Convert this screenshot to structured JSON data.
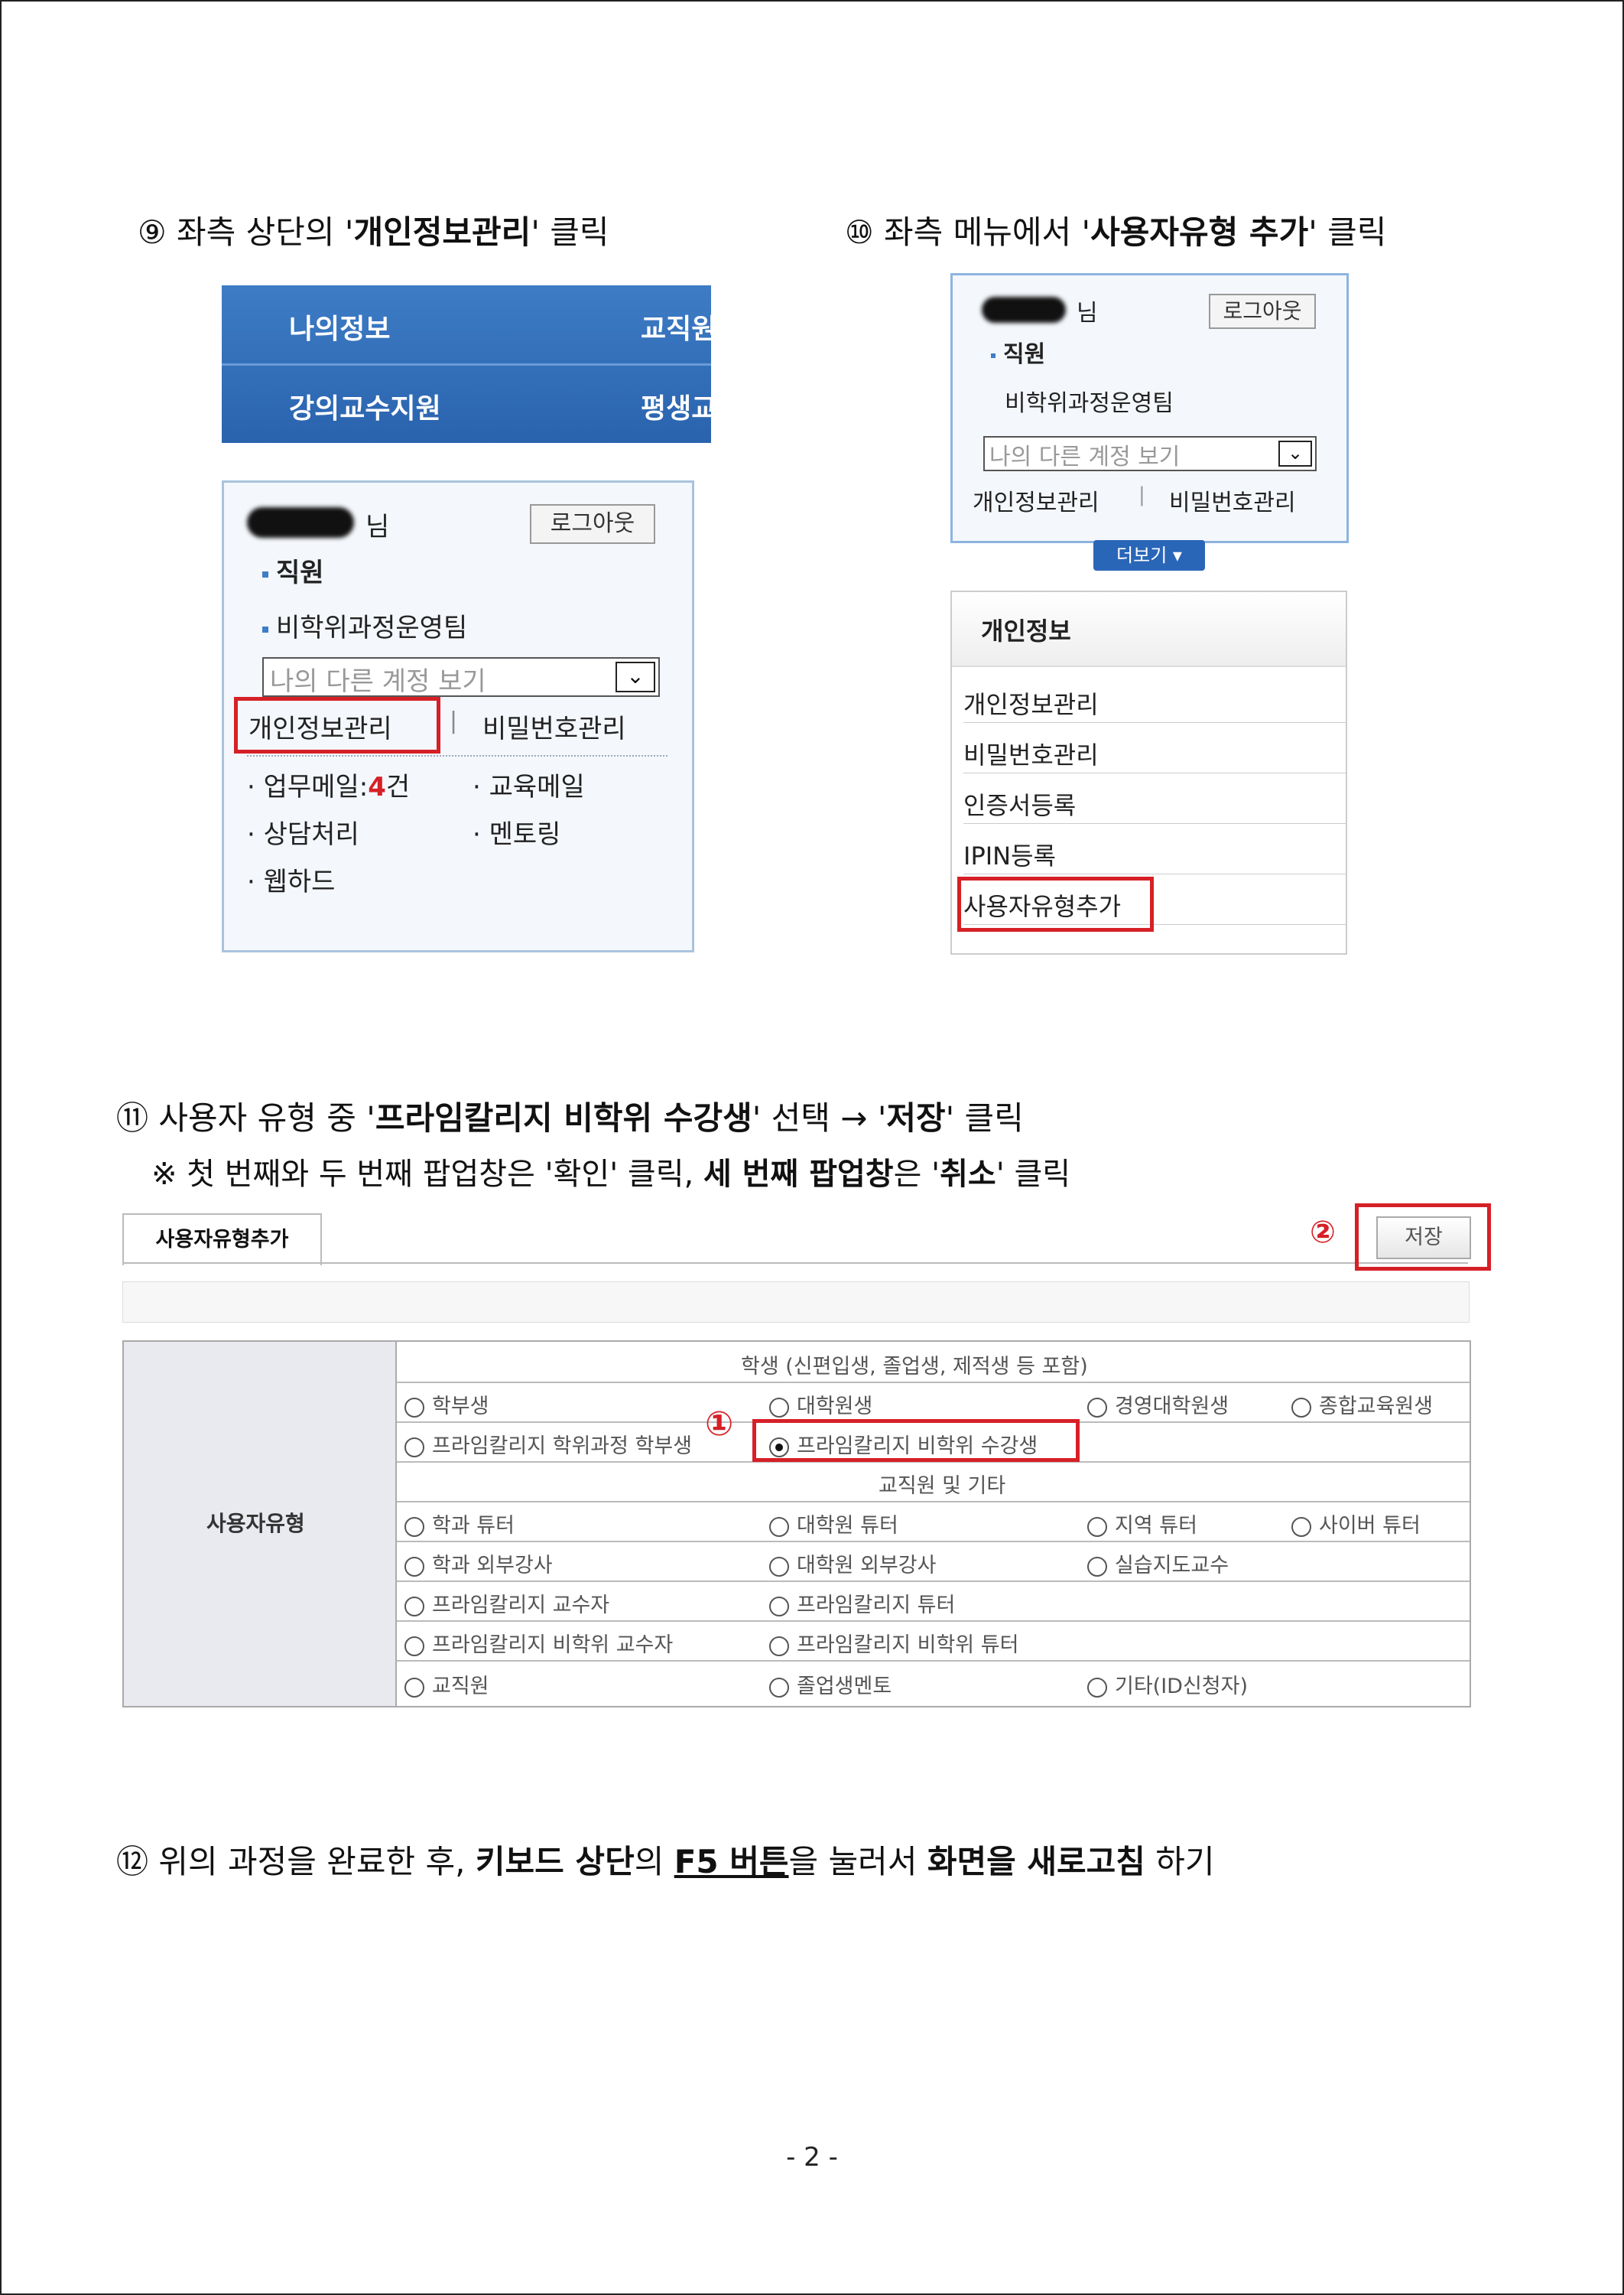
{
  "steps": {
    "s9_num": "⑨",
    "s9_pre": " 좌측 상단의 '",
    "s9_bold": "개인정보관리",
    "s9_post": "' 클릭",
    "s10_num": "⑩",
    "s10_pre": " 좌측 메뉴에서 '",
    "s10_bold": "사용자유형 추가",
    "s10_post": "' 클릭",
    "s11_num": "⑪",
    "s11_pre": " 사용자 유형 중 '",
    "s11_bold1": "프라임칼리지 비학위 수강생",
    "s11_mid": "' 선택 → '",
    "s11_bold2": "저장",
    "s11_post": "' 클릭",
    "note_pre": "※ 첫 번째와 두 번째 팝업창은 '확인' 클릭, ",
    "note_bold1": "세 번째 팝업창",
    "note_mid": "은 '",
    "note_bold2": "취소",
    "note_post": "' 클릭",
    "s12_num": "⑫",
    "s12_pre": " 위의 과정을 완료한 후, ",
    "s12_bold1": "키보드 상단",
    "s12_mid1": "의 ",
    "s12_bold2": "F5 버튼",
    "s12_mid2": "을 눌러서 ",
    "s12_bold3": "화면을 새로고침",
    "s12_post": " 하기"
  },
  "nav": {
    "item1": "나의정보",
    "item2": "교직원",
    "item3": "강의교수지원",
    "item4": "평생교"
  },
  "login_panel": {
    "suffix": "님",
    "logout": "로그아웃",
    "role": "직원",
    "team": "비학위과정운영팀",
    "select": "나의 다른 계정 보기",
    "link_profile": "개인정보관리",
    "sep": "|",
    "link_password": "비밀번호관리",
    "mail_label": "업무메일:",
    "mail_count": "4",
    "mail_unit": "건",
    "edu_mail": "교육메일",
    "counsel": "상담처리",
    "mentoring": "멘토링",
    "webhard": "웹하드"
  },
  "login_panel2": {
    "more": "더보기 ▾"
  },
  "submenu": {
    "title": "개인정보",
    "items": [
      "개인정보관리",
      "비밀번호관리",
      "인증서등록",
      "IPIN등록",
      "사용자유형추가"
    ]
  },
  "form": {
    "tab": "사용자유형추가",
    "marker2": "②",
    "save": "저장",
    "label": "사용자유형",
    "marker1": "①",
    "section1": "학생 (신편입생, 졸업생, 제적생 등 포함)",
    "section2": "교직원 및 기타",
    "r1": [
      "학부생",
      "대학원생",
      "경영대학원생",
      "종합교육원생"
    ],
    "r2": [
      "프라임칼리지 학위과정 학부생",
      "프라임칼리지 비학위 수강생"
    ],
    "r3": [
      "학과 튜터",
      "대학원 튜터",
      "지역 튜터",
      "사이버 튜터"
    ],
    "r4": [
      "학과 외부강사",
      "대학원 외부강사",
      "실습지도교수"
    ],
    "r5": [
      "프라임칼리지 교수자",
      "프라임칼리지 튜터"
    ],
    "r6": [
      "프라임칼리지 비학위 교수자",
      "프라임칼리지 비학위 튜터"
    ],
    "r7": [
      "교직원",
      "졸업생멘토",
      "기타(ID신청자)"
    ]
  },
  "page_number": "- 2 -"
}
